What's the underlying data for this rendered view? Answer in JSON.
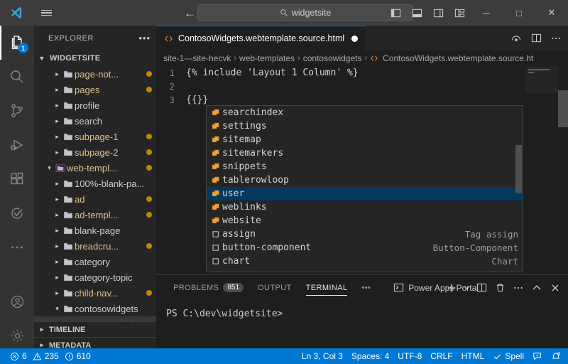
{
  "titlebar": {
    "search_value": "widgetsite",
    "search_icon": "search-icon",
    "back_icon": "arrow-left-icon",
    "forward_icon": "arrow-right-icon",
    "logo_icon": "vscode-logo-icon",
    "menu_icon": "hamburger-menu-icon",
    "layout_icons": [
      "toggle-primary-sidebar-icon",
      "toggle-panel-icon",
      "toggle-secondary-sidebar-icon",
      "customize-layout-icon"
    ],
    "window_controls": [
      "minimize-button",
      "maximize-button",
      "close-button"
    ],
    "minimize_label": "─",
    "maximize_label": "□",
    "close_label": "✕"
  },
  "activitybar": {
    "items": [
      {
        "name": "explorer",
        "icon": "files-icon",
        "badge": "1",
        "active": true
      },
      {
        "name": "search",
        "icon": "search-icon",
        "badge": "",
        "active": false
      },
      {
        "name": "source-control",
        "icon": "source-control-icon",
        "badge": "",
        "active": false
      },
      {
        "name": "run-and-debug",
        "icon": "run-debug-icon",
        "badge": "",
        "active": false
      },
      {
        "name": "extensions",
        "icon": "extensions-icon",
        "badge": "",
        "active": false
      },
      {
        "name": "testing",
        "icon": "testing-icon",
        "badge": "",
        "active": false
      },
      {
        "name": "additional-views",
        "icon": "ellipsis-icon",
        "badge": "",
        "active": false
      }
    ],
    "bottom_items": [
      {
        "name": "accounts",
        "icon": "account-icon"
      },
      {
        "name": "manage",
        "icon": "gear-icon"
      }
    ]
  },
  "sidebar": {
    "title": "EXPLORER",
    "more_actions": "•••",
    "root_label": "WIDGETSITE",
    "tree": [
      {
        "label": "page-not...",
        "indent": 2,
        "modified": true,
        "twisty": "›",
        "icon": "folder-icon"
      },
      {
        "label": "pages",
        "indent": 2,
        "modified": true,
        "twisty": "›",
        "icon": "folder-icon"
      },
      {
        "label": "profile",
        "indent": 2,
        "modified": false,
        "twisty": "›",
        "icon": "folder-icon"
      },
      {
        "label": "search",
        "indent": 2,
        "modified": false,
        "twisty": "›",
        "icon": "folder-icon"
      },
      {
        "label": "subpage-1",
        "indent": 2,
        "modified": true,
        "twisty": "›",
        "icon": "folder-icon"
      },
      {
        "label": "subpage-2",
        "indent": 2,
        "modified": true,
        "twisty": "›",
        "icon": "folder-icon"
      },
      {
        "label": "web-templ...",
        "indent": 1,
        "modified": true,
        "twisty": "⌄",
        "icon": "folder-open-icon"
      },
      {
        "label": "100%-blank-pa...",
        "indent": 2,
        "modified": false,
        "twisty": "›",
        "icon": "folder-icon"
      },
      {
        "label": "ad",
        "indent": 2,
        "modified": true,
        "twisty": "›",
        "icon": "folder-icon"
      },
      {
        "label": "ad-templ...",
        "indent": 2,
        "modified": true,
        "twisty": "›",
        "icon": "folder-icon"
      },
      {
        "label": "blank-page",
        "indent": 2,
        "modified": false,
        "twisty": "›",
        "icon": "folder-icon"
      },
      {
        "label": "breadcru...",
        "indent": 2,
        "modified": true,
        "twisty": "›",
        "icon": "folder-icon"
      },
      {
        "label": "category",
        "indent": 2,
        "modified": false,
        "twisty": "›",
        "icon": "folder-icon"
      },
      {
        "label": "category-topic",
        "indent": 2,
        "modified": false,
        "twisty": "›",
        "icon": "folder-icon"
      },
      {
        "label": "child-nav...",
        "indent": 2,
        "modified": true,
        "twisty": "›",
        "icon": "folder-icon"
      },
      {
        "label": "contosowidgets",
        "indent": 2,
        "modified": false,
        "twisty": "⌄",
        "icon": "folder-icon"
      },
      {
        "label": "ContosoWidg",
        "indent": 3,
        "modified": false,
        "twisty": "",
        "icon": "html-file-icon",
        "selected": true
      }
    ],
    "sections": [
      {
        "label": "TIMELINE",
        "twisty": "›"
      },
      {
        "label": "METADATA",
        "twisty": "›"
      }
    ]
  },
  "editor": {
    "tab": {
      "label": "ContosoWidgets.webtemplate.source.html",
      "icon": "html-file-icon",
      "dirty": true
    },
    "tab_actions": [
      "split-editor-icon",
      "more-actions-icon"
    ],
    "breadcrumbs": [
      "site-1---site-hecvk",
      "web-templates",
      "contosowidgets",
      "ContosoWidgets.webtemplate.source.ht"
    ],
    "breadcrumb_separator": "›",
    "lines": [
      {
        "num": "1",
        "text": "{% include 'Layout 1 Column' %}"
      },
      {
        "num": "2",
        "text": ""
      },
      {
        "num": "3",
        "text": "{{}}"
      }
    ]
  },
  "suggest": {
    "items": [
      {
        "label": "searchindex",
        "detail": "",
        "icon": "module-icon",
        "selected": false
      },
      {
        "label": "settings",
        "detail": "",
        "icon": "module-icon",
        "selected": false
      },
      {
        "label": "sitemap",
        "detail": "",
        "icon": "module-icon",
        "selected": false
      },
      {
        "label": "sitemarkers",
        "detail": "",
        "icon": "module-icon",
        "selected": false
      },
      {
        "label": "snippets",
        "detail": "",
        "icon": "module-icon",
        "selected": false
      },
      {
        "label": "tablerowloop",
        "detail": "",
        "icon": "module-icon",
        "selected": false
      },
      {
        "label": "user",
        "detail": "",
        "icon": "module-icon",
        "selected": true
      },
      {
        "label": "weblinks",
        "detail": "",
        "icon": "module-icon",
        "selected": false
      },
      {
        "label": "website",
        "detail": "",
        "icon": "module-icon",
        "selected": false
      },
      {
        "label": "assign",
        "detail": "Tag assign",
        "icon": "property-icon",
        "selected": false
      },
      {
        "label": "button-component",
        "detail": "Button-Component",
        "icon": "property-icon",
        "selected": false
      },
      {
        "label": "chart",
        "detail": "Chart",
        "icon": "property-icon",
        "selected": false
      }
    ]
  },
  "panel": {
    "tabs": [
      {
        "label": "PROBLEMS",
        "badge": "851",
        "active": false
      },
      {
        "label": "OUTPUT",
        "badge": "",
        "active": false
      },
      {
        "label": "TERMINAL",
        "badge": "",
        "active": true
      }
    ],
    "more_tabs": "•••",
    "terminal_name": "Power Apps Portal",
    "terminal_icon": "terminal-icon",
    "actions": [
      "new-terminal-icon",
      "terminal-dropdown-icon",
      "split-terminal-icon",
      "kill-terminal-icon",
      "panel-more-icon",
      "maximize-panel-icon",
      "close-panel-icon"
    ],
    "terminal_text": "PS C:\\dev\\widgetsite>"
  },
  "statusbar": {
    "errors": "6",
    "warnings": "235",
    "infos": "610",
    "error_icon": "error-circle-icon",
    "warning_icon": "warning-triangle-icon",
    "info_icon": "info-circle-icon",
    "cursor_position": "Ln 3, Col 3",
    "indentation": "Spaces: 4",
    "encoding": "UTF-8",
    "eol": "CRLF",
    "language": "HTML",
    "spell": "Spell",
    "spell_icon": "check-icon",
    "feedback_icon": "feedback-icon",
    "bell_icon": "bell-dot-icon",
    "accent_color": "#0078d4"
  }
}
